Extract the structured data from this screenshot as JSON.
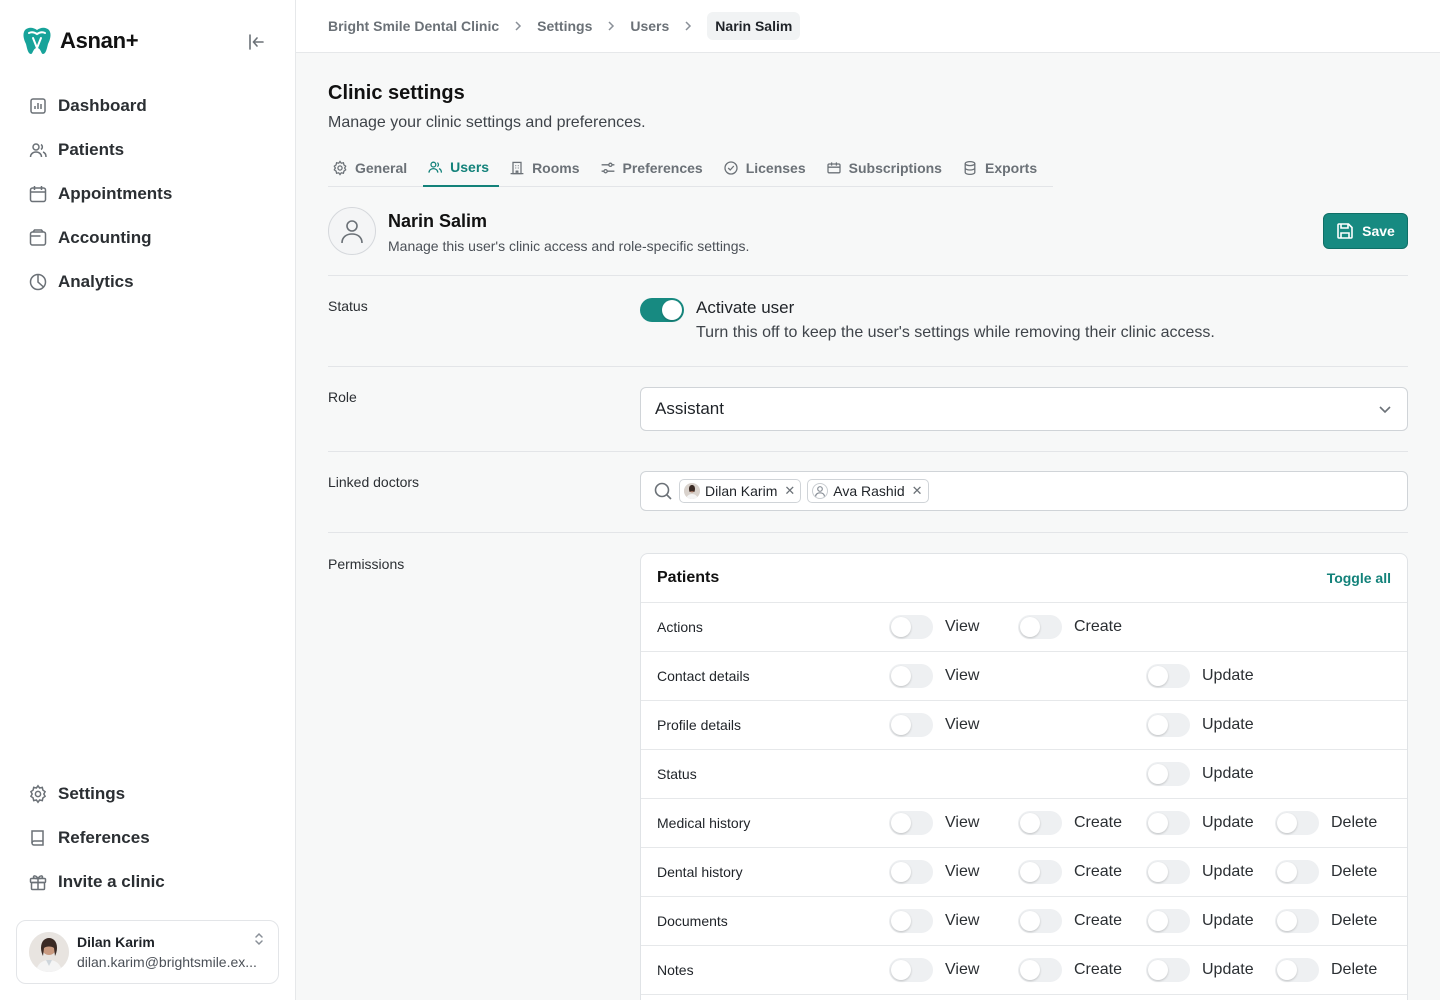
{
  "app": {
    "name": "Asnan+"
  },
  "sidebar": {
    "items": [
      {
        "label": "Dashboard",
        "icon": "dashboard-icon"
      },
      {
        "label": "Patients",
        "icon": "patients-icon"
      },
      {
        "label": "Appointments",
        "icon": "calendar-icon"
      },
      {
        "label": "Accounting",
        "icon": "wallet-icon"
      },
      {
        "label": "Analytics",
        "icon": "pie-chart-icon"
      }
    ],
    "bottom_items": [
      {
        "label": "Settings",
        "icon": "gear-icon"
      },
      {
        "label": "References",
        "icon": "book-icon"
      },
      {
        "label": "Invite a clinic",
        "icon": "gift-icon"
      }
    ],
    "user": {
      "name": "Dilan Karim",
      "email": "dilan.karim@brightsmile.ex..."
    }
  },
  "breadcrumb": [
    "Bright Smile Dental Clinic",
    "Settings",
    "Users",
    "Narin Salim"
  ],
  "page": {
    "title": "Clinic settings",
    "subtitle": "Manage your clinic settings and preferences."
  },
  "tabs": [
    "General",
    "Users",
    "Rooms",
    "Preferences",
    "Licenses",
    "Subscriptions",
    "Exports"
  ],
  "active_tab": "Users",
  "user_header": {
    "name": "Narin Salim",
    "description": "Manage this user's clinic access and role-specific settings.",
    "save_label": "Save"
  },
  "status": {
    "label": "Status",
    "toggle_on": true,
    "title": "Activate user",
    "description": "Turn this off to keep the user's settings while removing their clinic access."
  },
  "role": {
    "label": "Role",
    "value": "Assistant"
  },
  "linked_doctors": {
    "label": "Linked doctors",
    "chips": [
      "Dilan Karim",
      "Ava Rashid"
    ]
  },
  "permissions": {
    "label": "Permissions",
    "section_title": "Patients",
    "toggle_all_label": "Toggle all",
    "rows": [
      {
        "label": "Actions",
        "cells": [
          "View",
          "Create",
          null,
          null
        ]
      },
      {
        "label": "Contact details",
        "cells": [
          "View",
          null,
          "Update",
          null
        ]
      },
      {
        "label": "Profile details",
        "cells": [
          "View",
          null,
          "Update",
          null
        ]
      },
      {
        "label": "Status",
        "cells": [
          null,
          null,
          "Update",
          null
        ]
      },
      {
        "label": "Medical history",
        "cells": [
          "View",
          "Create",
          "Update",
          "Delete"
        ]
      },
      {
        "label": "Dental history",
        "cells": [
          "View",
          "Create",
          "Update",
          "Delete"
        ]
      },
      {
        "label": "Documents",
        "cells": [
          "View",
          "Create",
          "Update",
          "Delete"
        ]
      },
      {
        "label": "Notes",
        "cells": [
          "View",
          "Create",
          "Update",
          "Delete"
        ]
      }
    ]
  },
  "colors": {
    "accent": "#178a81",
    "accent_text": "#13827a",
    "border": "#e3e5e8"
  }
}
